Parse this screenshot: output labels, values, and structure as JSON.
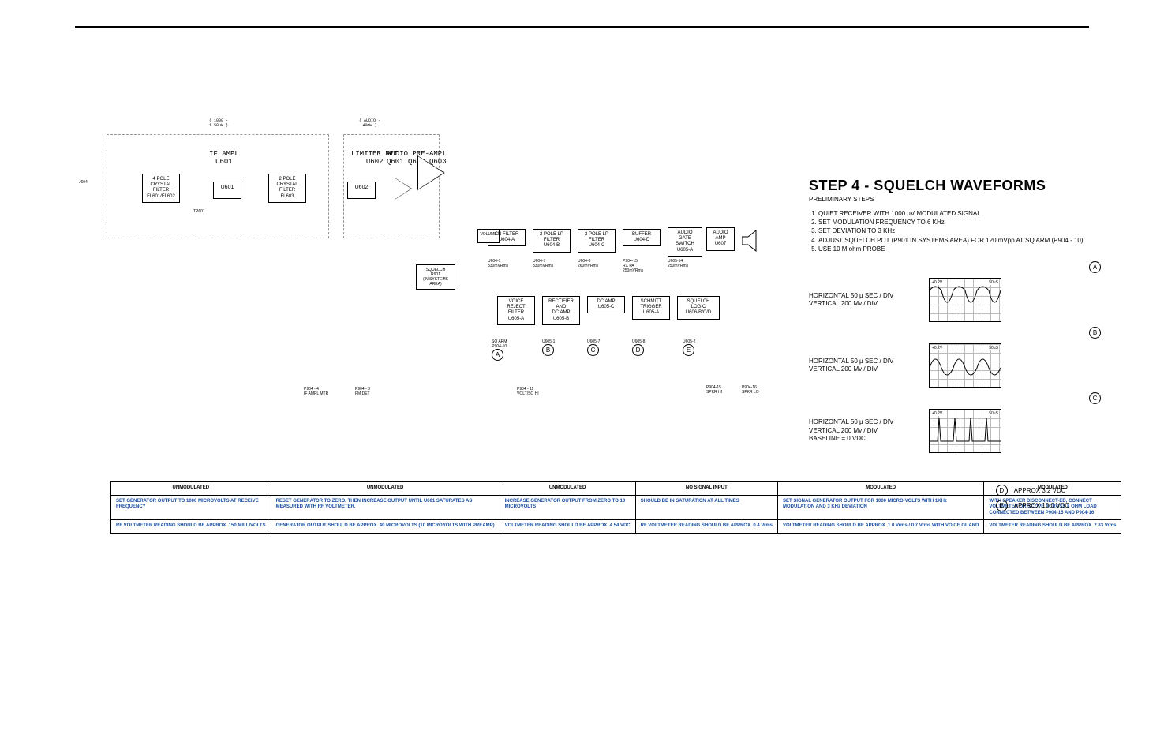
{
  "header_rule": true,
  "diagram": {
    "sections": [
      {
        "id": "ifampl",
        "title": "IF AMPL",
        "sub": "U601",
        "sublabel": "( 1000 -\n1 50uW )"
      },
      {
        "id": "limdet",
        "title": "LIMITER DET",
        "sub": "U602",
        "sublabel": "( AUDIO -\n40mW )"
      },
      {
        "id": "preamp",
        "title": "AUDIO PRE-AMPL",
        "sub": "Q601   Q602   Q603"
      }
    ],
    "blocks": [
      {
        "id": "xtal4",
        "text": "4 POLE\nCRYSTAL\nFILTER\nFL601/FL602"
      },
      {
        "id": "u601",
        "text": "U601"
      },
      {
        "id": "xtal2",
        "text": "2 POLE\nCRYSTAL\nFILTER\nFL603"
      },
      {
        "id": "u602",
        "text": "U602"
      },
      {
        "id": "cr",
        "text": "CR FILTER\nU604-A",
        "sub": "U604-1\n330mVRms"
      },
      {
        "id": "lp1",
        "text": "2 POLE LP\nFILTER\nU604-B",
        "sub": "U604-7\n330mVRms"
      },
      {
        "id": "lp2",
        "text": "2 POLE LP\nFILTER\nU604-C",
        "sub": "U604-8\n260mVRms"
      },
      {
        "id": "buffer",
        "text": "BUFFER\nU604-D",
        "sub": "P904-15\nRX PA\n250mVRms"
      },
      {
        "id": "gate",
        "text": "AUDIO\nGATE\nSWITCH\nU605-A",
        "sub": "U605-14\n250mVRms"
      },
      {
        "id": "amp",
        "text": "AUDIO\nAMP\nU607"
      },
      {
        "id": "vol",
        "text": "VOLUME"
      },
      {
        "id": "sqbox",
        "text": "SQUELCH\nR901\n(IN SYSTEMS\nAREA)"
      },
      {
        "id": "vreject",
        "text": "VOICE\nREJECT\nFILTER\nU605-A"
      },
      {
        "id": "rectdc",
        "text": "RECTIFIER\nAND\nDC AMP\nU605-B"
      },
      {
        "id": "dcamp",
        "text": "DC AMP\nU605-C"
      },
      {
        "id": "schmitt",
        "text": "SCHMITT\nTRIGGER\nU605-A"
      },
      {
        "id": "sqlogic",
        "text": "SQUELCH\nLOGIC\nU606-B/C/D"
      }
    ],
    "tp_row": [
      {
        "id": "a",
        "label": "SQ ARM\nP904-10",
        "circ": "A"
      },
      {
        "id": "b",
        "label": "U605-1",
        "circ": "B"
      },
      {
        "id": "c",
        "label": "U605-7",
        "circ": "C"
      },
      {
        "id": "d",
        "label": "U605-8",
        "circ": "D"
      },
      {
        "id": "e",
        "label": "U605-2",
        "circ": "E"
      }
    ],
    "testpoints": [
      {
        "id": "j604",
        "text": "J604"
      },
      {
        "id": "tp601",
        "text": "TP601"
      },
      {
        "id": "p9044",
        "text": "P904 - 4\nIF AMPL MTR"
      },
      {
        "id": "p9043",
        "text": "P904 - 3\nFM DET"
      },
      {
        "id": "p90411",
        "text": "P904 - 11\nVOLT/SQ HI"
      },
      {
        "id": "p90415",
        "text": "P904-15\nSPKR HI"
      },
      {
        "id": "p90416",
        "text": "P904-16\nSPKR LO"
      }
    ]
  },
  "table": {
    "cols": [
      {
        "h": "UNMODULATED",
        "r1": "SET GENERATOR OUTPUT TO 1000 MICROVOLTS AT RECEIVE FREQUENCY",
        "r2": "RF VOLTMETER READING SHOULD BE APPROX. 150 MILLIVOLTS"
      },
      {
        "h": "UNMODULATED",
        "r1": "RESET GENERATOR TO ZERO, THEN INCREASE OUTPUT UNTIL U601 SATURATES AS MEASURED WITH RF VOLTMETER.",
        "r2": "GENERATOR OUTPUT SHOULD BE APPROX. 40 MICROVOLTS (10 MICROVOLTS WITH PREAMP)"
      },
      {
        "h": "UNMODULATED",
        "r1": "INCREASE GENERATOR OUTPUT FROM ZERO TO 10 MICROVOLTS",
        "r2": "VOLTMETER READING SHOULD BE APPROX. 4.54 VDC"
      },
      {
        "h": "NO SIGNAL INPUT",
        "r1": "SHOULD BE IN SATURATION AT ALL TIMES",
        "r2": "RF VOLTMETER READING SHOULD BE APPROX. 0.4 Vrms"
      },
      {
        "h": "MODULATED",
        "r1": "SET SIGNAL GENERATOR OUTPUT FOR 1000 MICRO-VOLTS WITH 1KHz MODULATION AND 3 KHz DEVIATION",
        "r2": "VOLTMETER READING SHOULD BE APPROX. 1.0 Vrms / 0.7 Vrms WITH VOICE GUARD"
      },
      {
        "h": "MODULATED",
        "r1": "WITH SPEAKER DISCONNECT-ED, CONNECT VOLTMETER OR SCOPE ACROSS 8 OHM LOAD CONNECTED BETWEEN P904-15 AND P904-16",
        "r2": "VOLTMETER READING SHOULD BE APPROX. 2.83 Vrms"
      }
    ]
  },
  "step4": {
    "title": "STEP 4 - SQUELCH WAVEFORMS",
    "subtitle": "PRELIMINARY STEPS",
    "steps": [
      "QUIET RECEIVER WITH 1000 µV MODULATED SIGNAL",
      "SET MODULATION FREQUENCY TO 6 KHz",
      "SET DEVIATION TO 3 KHz",
      "ADJUST SQUELCH POT (P901 IN SYSTEMS AREA) FOR 120 mVpp AT SQ ARM (P904 - 10)",
      "USE 10 M ohm PROBE"
    ],
    "waves": [
      {
        "circ": "A",
        "txt": "HORIZONTAL 50 µ SEC / DIV\nVERTICAL 200 Mv / DIV",
        "top": "+0.2V",
        "right": "50µS"
      },
      {
        "circ": "B",
        "txt": "HORIZONTAL 50 µ SEC / DIV\nVERTICAL 200 Mv / DIV",
        "top": "+0.2V",
        "right": "50µS"
      },
      {
        "circ": "C",
        "txt": "HORIZONTAL 50 µ SEC / DIV\nVERTICAL 200 Mv / DIV\nBASELINE = 0 VDC",
        "top": "+0.2V",
        "right": "50µS"
      }
    ],
    "de": [
      {
        "circ": "D",
        "txt": "APPROX 3.2 VDC"
      },
      {
        "circ": "E",
        "txt": "APPROX 10.0 VDC"
      }
    ]
  }
}
